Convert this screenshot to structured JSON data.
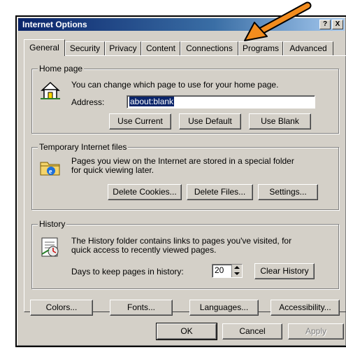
{
  "window": {
    "title": "Internet Options",
    "title_buttons": [
      "?",
      "X"
    ]
  },
  "tabs": [
    {
      "label": "General",
      "active": true
    },
    {
      "label": "Security",
      "active": false
    },
    {
      "label": "Privacy",
      "active": false
    },
    {
      "label": "Content",
      "active": false
    },
    {
      "label": "Connections",
      "active": false
    },
    {
      "label": "Programs",
      "active": false
    },
    {
      "label": "Advanced",
      "active": false
    }
  ],
  "home_page": {
    "legend": "Home page",
    "description": "You can change which page to use for your home page.",
    "address_label": "Address:",
    "address_value": "about:blank",
    "buttons": {
      "use_current": "Use Current",
      "use_default": "Use Default",
      "use_blank": "Use Blank"
    }
  },
  "temp_files": {
    "legend": "Temporary Internet files",
    "description_line1": "Pages you view on the Internet are stored in a special folder",
    "description_line2": "for quick viewing later.",
    "buttons": {
      "delete_cookies": "Delete Cookies...",
      "delete_files": "Delete Files...",
      "settings": "Settings..."
    }
  },
  "history": {
    "legend": "History",
    "description_line1": "The History folder contains links to pages you've visited, for",
    "description_line2": "quick access to recently viewed pages.",
    "days_label": "Days to keep pages in history:",
    "days_value": "20",
    "clear_button": "Clear History"
  },
  "bottom_buttons": {
    "colors": "Colors...",
    "fonts": "Fonts...",
    "languages": "Languages...",
    "accessibility": "Accessibility..."
  },
  "dialog_buttons": {
    "ok": "OK",
    "cancel": "Cancel",
    "apply": "Apply"
  },
  "annotation": {
    "arrow_color": "#f28c1e"
  }
}
